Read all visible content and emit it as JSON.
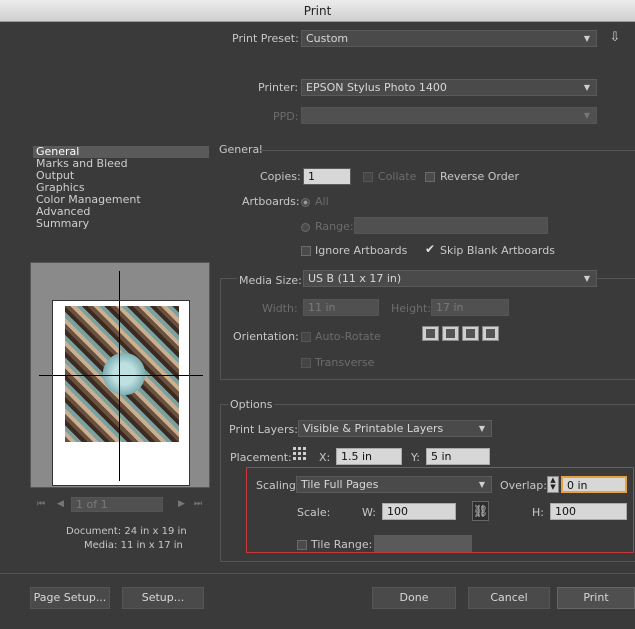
{
  "window": {
    "title": "Print"
  },
  "preset": {
    "label": "Print Preset:",
    "value": "Custom"
  },
  "printer": {
    "label": "Printer:",
    "value": "EPSON Stylus Photo 1400"
  },
  "ppd": {
    "label": "PPD:",
    "value": ""
  },
  "sidebar": {
    "items": [
      {
        "label": "General",
        "selected": true
      },
      {
        "label": "Marks and Bleed",
        "selected": false
      },
      {
        "label": "Output",
        "selected": false
      },
      {
        "label": "Graphics",
        "selected": false
      },
      {
        "label": "Color Management",
        "selected": false
      },
      {
        "label": "Advanced",
        "selected": false
      },
      {
        "label": "Summary",
        "selected": false
      }
    ]
  },
  "general": {
    "section_title": "General",
    "copies_label": "Copies:",
    "copies_value": "1",
    "collate_label": "Collate",
    "reverse_label": "Reverse Order",
    "artboards_label": "Artboards:",
    "all_label": "All",
    "range_label": "Range:",
    "ignore_label": "Ignore Artboards",
    "skip_label": "Skip Blank Artboards"
  },
  "media": {
    "size_label": "Media Size:",
    "size_value": "US B (11 x 17 in)",
    "width_label": "Width:",
    "width_value": "11 in",
    "height_label": "Height:",
    "height_value": "17 in",
    "orientation_label": "Orientation:",
    "auto_rotate_label": "Auto-Rotate",
    "transverse_label": "Transverse"
  },
  "options": {
    "section_title": "Options",
    "layers_label": "Print Layers:",
    "layers_value": "Visible & Printable Layers",
    "placement_label": "Placement:",
    "x_label": "X:",
    "x_value": "1.5 in",
    "y_label": "Y:",
    "y_value": "5 in",
    "scaling_label": "Scaling:",
    "scaling_value": "Tile Full Pages",
    "overlap_label": "Overlap:",
    "overlap_value": "0 in",
    "scale_label": "Scale:",
    "w_label": "W:",
    "w_value": "100",
    "h_label": "H:",
    "h_value": "100",
    "tile_range_label": "Tile Range:",
    "highlight_color": "#c8383a"
  },
  "preview": {
    "page_nav": "1 of 1",
    "document_label": "Document: 24 in x 19 in",
    "media_label": "Media: 11 in x 17 in"
  },
  "footer": {
    "page_setup": "Page Setup...",
    "setup": "Setup...",
    "done": "Done",
    "cancel": "Cancel",
    "print": "Print"
  }
}
